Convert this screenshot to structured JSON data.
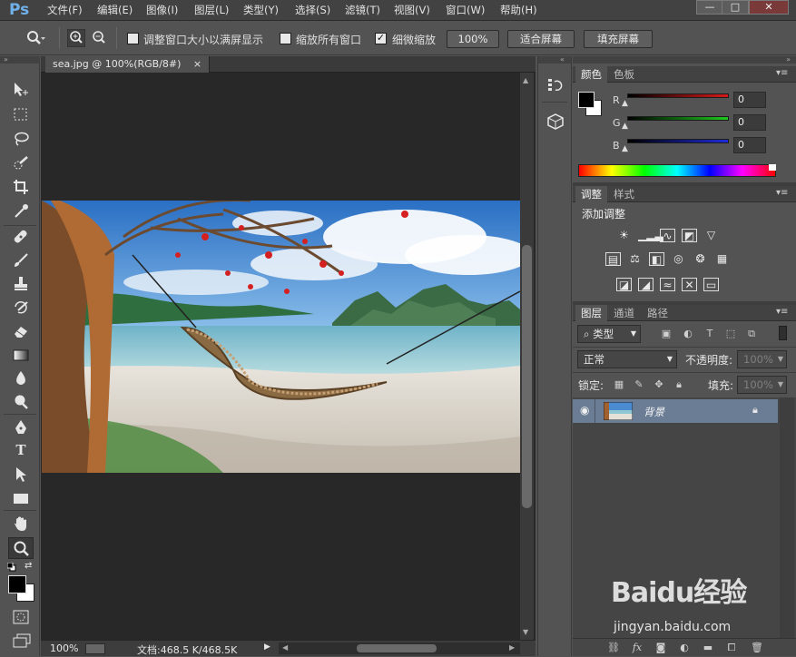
{
  "app": {
    "logo": "Ps"
  },
  "menu": [
    "文件(F)",
    "编辑(E)",
    "图像(I)",
    "图层(L)",
    "类型(Y)",
    "选择(S)",
    "滤镜(T)",
    "视图(V)",
    "窗口(W)",
    "帮助(H)"
  ],
  "window_controls": {
    "minimize": "—",
    "maximize": "□",
    "close": "✕"
  },
  "options_bar": {
    "resize_windows_label": "调整窗口大小以满屏显示",
    "zoom_all_windows_label": "缩放所有窗口",
    "scrubby_zoom_label": "细微缩放",
    "scrubby_zoom_checked": true,
    "zoom_100": "100%",
    "fit_screen": "适合屏幕",
    "fill_screen": "填充屏幕"
  },
  "document": {
    "tab_title": "sea.jpg @ 100%(RGB/8#)",
    "tab_close": "×",
    "zoom": "100%",
    "doc_info": "文档:468.5 K/468.5K"
  },
  "color_panel": {
    "tabs": [
      "颜色",
      "色板"
    ],
    "channels": [
      {
        "label": "R",
        "value": "0",
        "color": "#d61a1a"
      },
      {
        "label": "G",
        "value": "0",
        "color": "#1ec91e"
      },
      {
        "label": "B",
        "value": "0",
        "color": "#1e2ad8"
      }
    ],
    "foreground": "#000000",
    "background": "#ffffff"
  },
  "adjustments_panel": {
    "tabs": [
      "调整",
      "样式"
    ],
    "title": "添加调整"
  },
  "layers_panel": {
    "tabs": [
      "图层",
      "通道",
      "路径"
    ],
    "filter_type": "类型",
    "blend_mode": "正常",
    "opacity_label": "不透明度:",
    "opacity_value": "100%",
    "lock_label": "锁定:",
    "fill_label": "填充:",
    "fill_value": "100%",
    "layers": [
      {
        "name": "背景",
        "locked": true,
        "visible": true
      }
    ]
  },
  "watermark": {
    "brand": "Baidu经验",
    "url": "jingyan.baidu.com"
  }
}
